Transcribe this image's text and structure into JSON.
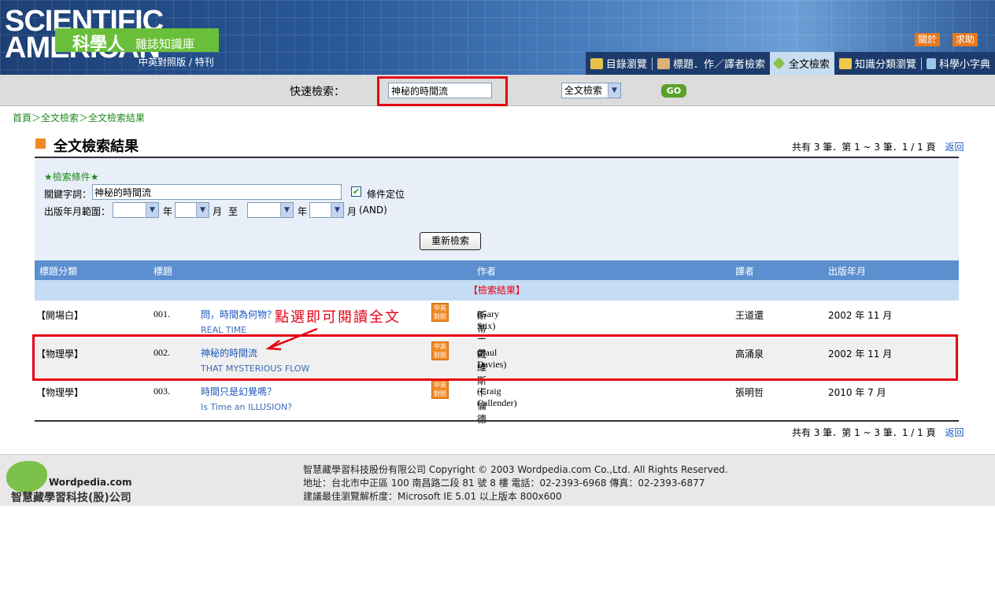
{
  "header": {
    "logo_en": "SCIENTIFIC AMERICAN",
    "logo_cn_big": "科學人",
    "logo_cn_small": "雜誌知識庫",
    "logo_sub": "中英對照版 / 特刊",
    "about": "關於",
    "help": "求助",
    "nav": [
      {
        "label": "目錄瀏覽",
        "icon": "book-icon"
      },
      {
        "label": "標題．作／譯者檢索",
        "icon": "people-icon"
      },
      {
        "label": "全文檢索",
        "icon": "diamond-icon"
      },
      {
        "label": "知識分類瀏覽",
        "icon": "folder-icon"
      },
      {
        "label": "科學小字典",
        "icon": "dictionary-icon"
      }
    ]
  },
  "quick_search": {
    "label": "快速檢索：",
    "value": "神秘的時間流",
    "type_selected": "全文檢索",
    "go_label": "GO"
  },
  "breadcrumb": "首頁＞全文檢索＞全文檢索結果",
  "page_title": "全文檢索結果",
  "pager": {
    "text": "共有 3 筆．第 1 ~ 3 筆．1 / 1 頁",
    "back": "返回"
  },
  "criteria": {
    "heading": "★檢索條件★",
    "keyword_label": "關鍵字詞：",
    "keyword_value": "神秘的時間流",
    "locate_label": "條件定位",
    "locate_checked": true,
    "date_label": "出版年月範圍：",
    "year_unit": "年",
    "month_unit": "月",
    "to": "至",
    "and": "(AND)",
    "submit": "重新檢索"
  },
  "table": {
    "headers": [
      "標題分類",
      "標題",
      "作者",
      "譯者",
      "出版年月"
    ],
    "subheader": "【檢索結果】",
    "rows": [
      {
        "category": "【開場白】",
        "no": "001.",
        "title_zh": "問，時間為何物？",
        "title_en": "REAL TIME",
        "author_zh": "斯蒂克斯",
        "author_en": "(Gary Stix)",
        "translator": "王道還",
        "date": "2002 年 11 月"
      },
      {
        "category": "【物理學】",
        "no": "002.",
        "title_zh": "神秘的時間流",
        "title_en": "THAT MYSTERIOUS FLOW",
        "author_zh": "戴維斯",
        "author_en": "(Paul Davies)",
        "translator": "高涌泉",
        "date": "2002 年 11 月"
      },
      {
        "category": "【物理學】",
        "no": "003.",
        "title_zh": "時間只是幻覺嗎？",
        "title_en": "Is Time an ILLUSION?",
        "author_zh": "卡倫德",
        "author_en": "(Craig Callender)",
        "translator": "張明哲",
        "date": "2010 年 7 月"
      }
    ],
    "bilingual_badge": "中英對照"
  },
  "annotation": "點選即可閱讀全文",
  "footer": {
    "logo_text": "Wordpedia.com",
    "logo_cn": "智慧藏學習科技(股)公司",
    "line1": "智慧藏學習科技股份有限公司 Copyright © 2003 Wordpedia.com Co.,Ltd. All Rights Reserved.",
    "line2": "地址：台北市中正區 100 南昌路二段 81 號 8 樓 電話：02-2393-6968 傳真：02-2393-6877",
    "line3": "建議最佳瀏覽解析度：Microsoft IE 5.01 以上版本 800x600"
  },
  "colors": {
    "accent_red": "#e60012",
    "header_blue": "#2a5a9a",
    "link_blue": "#1a55c0",
    "breadcrumb_green": "#1e8a1e",
    "go_green": "#5aa02a"
  }
}
